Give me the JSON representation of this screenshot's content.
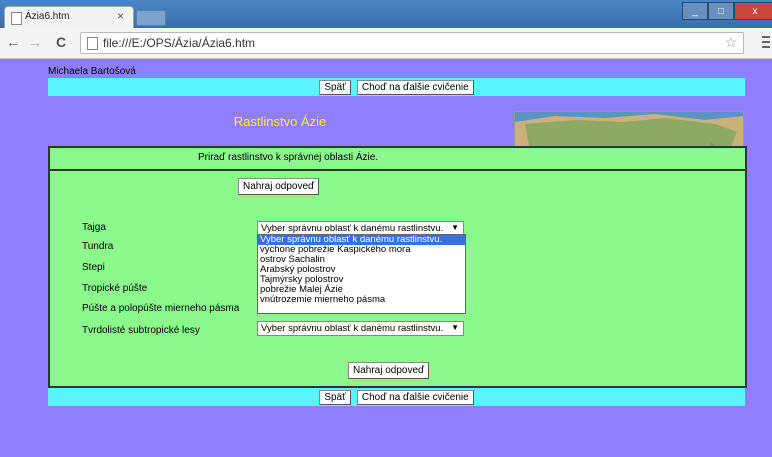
{
  "browser": {
    "tab_title": "Ázia6.htm",
    "tab_close": "×",
    "url": "file:///E:/OPS/Ázia/Ázia6.htm",
    "icons": {
      "back": "←",
      "forward": "→",
      "reload": "C",
      "star": "☆"
    }
  },
  "page": {
    "author": "Michaela Bartošová",
    "nav": {
      "back_label": "Späť",
      "next_label": "Choď na ďalšie cvičenie"
    },
    "heading": "Rastlinstvo Ázie",
    "instruction": "Priraď rastlinstvo k správnej oblasti Ázie.",
    "submit_label": "Nahraj odpoveď",
    "rows": [
      {
        "label": "Tajga",
        "selected": "Vyber správnu oblasť k danému rastlinstvu."
      },
      {
        "label": "Tundra"
      },
      {
        "label": "Stepi"
      },
      {
        "label": "Tropické púšte"
      },
      {
        "label": "Púšte a polopúšte mierneho pásma"
      },
      {
        "label": "Tvrdolisté subtropické lesy",
        "selected": "Vyber správnu oblasť k danému rastlinstvu."
      }
    ],
    "dropdown_options": [
      "Vyber správnu oblasť k danému rastlinstvu.",
      "výchone pobrežie Kaspického mora",
      "ostrov Sachalin",
      "Arabský polostrov",
      "Tajmýrsky polostrov",
      "pobrežie Malej Ázie",
      "vnútrozemie mierneho pásma"
    ],
    "colors": {
      "background": "#8f7fff",
      "nav_bar": "#5cf5ff",
      "panel": "#8cf98c",
      "heading": "#ffea3a"
    }
  }
}
